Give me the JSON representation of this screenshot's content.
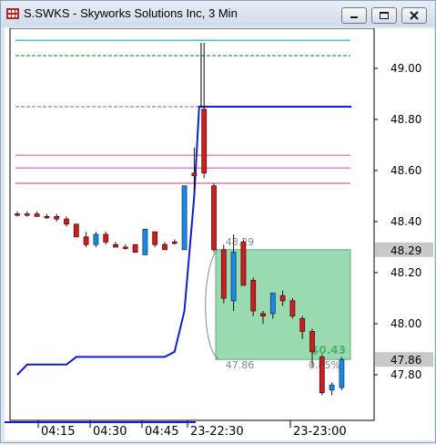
{
  "window": {
    "title": "S.SWKS - Skyworks Solutions Inc, 3 Min",
    "app_icon": "grid-app-icon",
    "controls": [
      "minimize-icon",
      "maximize-icon",
      "close-icon"
    ]
  },
  "chart_data": {
    "type": "candlestick",
    "title": "S.SWKS - Skyworks Solutions Inc, 3 Min",
    "y_ticks": [
      "49.00",
      "48.80",
      "48.60",
      "48.40",
      "48.20",
      "48.00",
      "47.80"
    ],
    "x_ticks": [
      "04:15",
      "04:30",
      "04:45",
      "23-22:30",
      "23-23:00"
    ],
    "ylim": [
      47.61,
      49.21
    ],
    "price_badges": [
      {
        "label": "48.29",
        "value": 48.29
      },
      {
        "label": "47.86",
        "value": 47.86
      }
    ],
    "box_labels": {
      "top": "48.29",
      "bottom": "47.86",
      "gain": "$0.43",
      "pct": "0.85%"
    },
    "colors": {
      "up": "#1e88e5",
      "down": "#cc1f1f",
      "up_edge": "#0c3a66",
      "down_edge": "#5a0c0c",
      "target_box": "#8ed6a8",
      "stop_line": "#1020c8",
      "guide_top": "#18a9b6",
      "guide_green": "#3a9a4a",
      "guide_pink": "#e05aa8",
      "guide_grey": "#b07890"
    },
    "reference_lines": [
      {
        "value": 49.11,
        "color": "#18a9b6",
        "style": "solid"
      },
      {
        "value": 49.16,
        "color": "#3a9a4a",
        "style": "dashed"
      },
      {
        "value": 49.05,
        "color": "#3a9a4a",
        "style": "dashed"
      },
      {
        "value": 48.85,
        "color": "#b07890",
        "style": "dashed"
      },
      {
        "value": 48.66,
        "color": "#e05aa8",
        "style": "solid"
      },
      {
        "value": 48.61,
        "color": "#e05aa8",
        "style": "solid"
      },
      {
        "value": 48.55,
        "color": "#e05aa8",
        "style": "solid"
      },
      {
        "value": 48.85,
        "color": "#1020c8",
        "style": "solid",
        "from_bar": 19
      }
    ],
    "stop_line": [
      {
        "bar": 0,
        "value": 47.8
      },
      {
        "bar": 1,
        "value": 47.84
      },
      {
        "bar": 5,
        "value": 47.84
      },
      {
        "bar": 6,
        "value": 47.87
      },
      {
        "bar": 15,
        "value": 47.87
      },
      {
        "bar": 16,
        "value": 47.89
      },
      {
        "bar": 17,
        "value": 48.05
      },
      {
        "bar": 18,
        "value": 48.5
      },
      {
        "bar": 18.5,
        "value": 48.85
      },
      {
        "bar": 34,
        "value": 48.85
      }
    ],
    "spike": {
      "bar": 18.7,
      "high": 49.1
    },
    "candles": [
      {
        "o": 48.43,
        "h": 48.44,
        "l": 48.42,
        "c": 48.43
      },
      {
        "o": 48.43,
        "h": 48.44,
        "l": 48.42,
        "c": 48.43
      },
      {
        "o": 48.43,
        "h": 48.44,
        "l": 48.42,
        "c": 48.42
      },
      {
        "o": 48.42,
        "h": 48.43,
        "l": 48.41,
        "c": 48.42
      },
      {
        "o": 48.42,
        "h": 48.43,
        "l": 48.4,
        "c": 48.41
      },
      {
        "o": 48.41,
        "h": 48.42,
        "l": 48.38,
        "c": 48.39
      },
      {
        "o": 48.39,
        "h": 48.39,
        "l": 48.34,
        "c": 48.34
      },
      {
        "o": 48.34,
        "h": 48.36,
        "l": 48.3,
        "c": 48.31
      },
      {
        "o": 48.31,
        "h": 48.36,
        "l": 48.3,
        "c": 48.35
      },
      {
        "o": 48.35,
        "h": 48.36,
        "l": 48.31,
        "c": 48.32
      },
      {
        "o": 48.31,
        "h": 48.32,
        "l": 48.3,
        "c": 48.3
      },
      {
        "o": 48.3,
        "h": 48.31,
        "l": 48.29,
        "c": 48.3
      },
      {
        "o": 48.31,
        "h": 48.31,
        "l": 48.28,
        "c": 48.28
      },
      {
        "o": 48.27,
        "h": 48.37,
        "l": 48.27,
        "c": 48.37
      },
      {
        "o": 48.36,
        "h": 48.36,
        "l": 48.3,
        "c": 48.31
      },
      {
        "o": 48.31,
        "h": 48.32,
        "l": 48.29,
        "c": 48.29
      },
      {
        "o": 48.32,
        "h": 48.33,
        "l": 48.31,
        "c": 48.32
      },
      {
        "o": 48.29,
        "h": 48.54,
        "l": 48.29,
        "c": 48.54
      },
      {
        "o": 48.59,
        "h": 48.69,
        "l": 48.52,
        "c": 48.58
      },
      {
        "o": 48.84,
        "h": 49.1,
        "l": 48.57,
        "c": 48.59
      },
      {
        "o": 48.54,
        "h": 48.55,
        "l": 48.28,
        "c": 48.29
      },
      {
        "o": 48.29,
        "h": 48.31,
        "l": 48.08,
        "c": 48.1
      },
      {
        "o": 48.09,
        "h": 48.35,
        "l": 48.05,
        "c": 48.28
      },
      {
        "o": 48.32,
        "h": 48.33,
        "l": 48.15,
        "c": 48.15
      },
      {
        "o": 48.17,
        "h": 48.18,
        "l": 48.03,
        "c": 48.05
      },
      {
        "o": 48.04,
        "h": 48.05,
        "l": 48.0,
        "c": 48.03
      },
      {
        "o": 48.04,
        "h": 48.12,
        "l": 48.02,
        "c": 48.12
      },
      {
        "o": 48.11,
        "h": 48.13,
        "l": 48.07,
        "c": 48.09
      },
      {
        "o": 48.09,
        "h": 48.1,
        "l": 48.02,
        "c": 48.03
      },
      {
        "o": 48.02,
        "h": 48.03,
        "l": 47.94,
        "c": 47.97
      },
      {
        "o": 47.97,
        "h": 47.98,
        "l": 47.83,
        "c": 47.89
      },
      {
        "o": 47.87,
        "h": 47.88,
        "l": 47.72,
        "c": 47.73
      },
      {
        "o": 47.74,
        "h": 47.77,
        "l": 47.72,
        "c": 47.76
      },
      {
        "o": 47.75,
        "h": 47.87,
        "l": 47.74,
        "c": 47.86
      }
    ]
  }
}
